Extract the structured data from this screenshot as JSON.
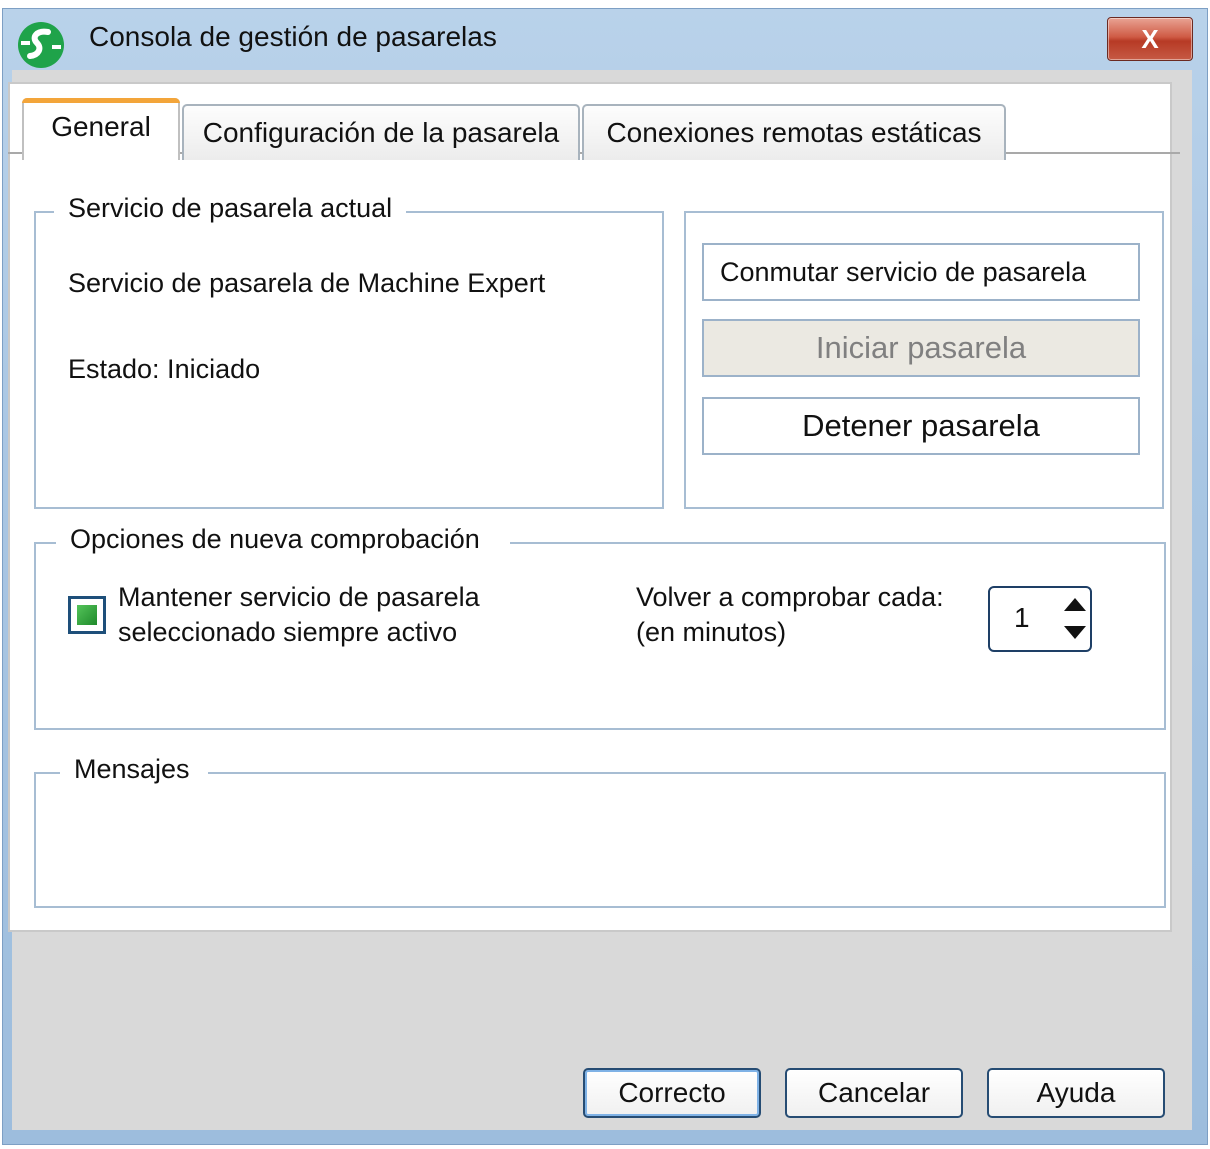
{
  "window": {
    "title": "Consola de gestión de pasarelas",
    "close_label": "X"
  },
  "tabs": [
    {
      "label": "General",
      "active": true
    },
    {
      "label": "Configuración de la pasarela",
      "active": false
    },
    {
      "label": "Conexiones remotas estáticas",
      "active": false
    }
  ],
  "current_service": {
    "legend": "Servicio de pasarela actual",
    "name": "Servicio de pasarela de Machine Expert",
    "status": "Estado: Iniciado"
  },
  "actions": {
    "switch_label": "Conmutar servicio de pasarela",
    "start_label": "Iniciar pasarela",
    "stop_label": "Detener pasarela"
  },
  "recheck": {
    "legend": "Opciones de nueva comprobación",
    "keep_active_line1": "Mantener servicio de pasarela",
    "keep_active_line2": "seleccionado siempre activo",
    "keep_active_checked": true,
    "interval_label_line1": "Volver a comprobar cada:",
    "interval_label_line2": "(en minutos)",
    "interval_value": "1"
  },
  "messages": {
    "legend": "Mensajes"
  },
  "footer": {
    "ok_label": "Correcto",
    "cancel_label": "Cancelar",
    "help_label": "Ayuda"
  },
  "colors": {
    "active_tab_accent": "#f3a53a",
    "checkbox_fill": "#2a9a35",
    "window_frame": "#a9c6e3"
  }
}
